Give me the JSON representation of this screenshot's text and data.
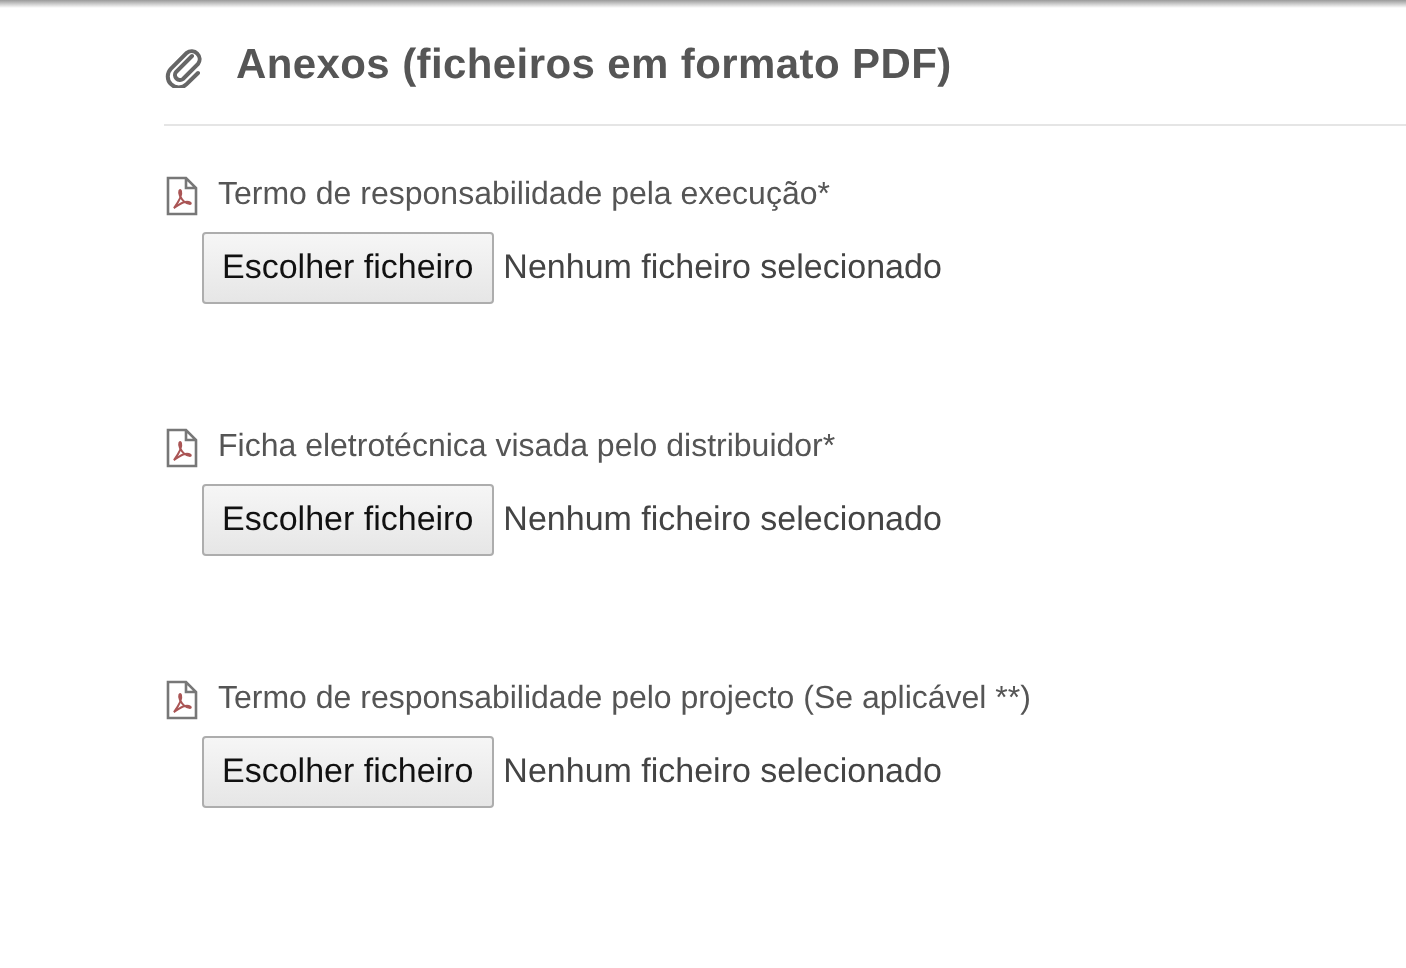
{
  "section": {
    "title": "Anexos (ficheiros em formato PDF)"
  },
  "attachments": [
    {
      "label": "Termo de responsabilidade pela execução*",
      "button": "Escolher ficheiro",
      "status": "Nenhum ficheiro selecionado"
    },
    {
      "label": "Ficha eletrotécnica visada pelo distribuidor*",
      "button": "Escolher ficheiro",
      "status": "Nenhum ficheiro selecionado"
    },
    {
      "label": "Termo de responsabilidade pelo projecto (Se aplicável **)",
      "button": "Escolher ficheiro",
      "status": "Nenhum ficheiro selecionado"
    }
  ]
}
